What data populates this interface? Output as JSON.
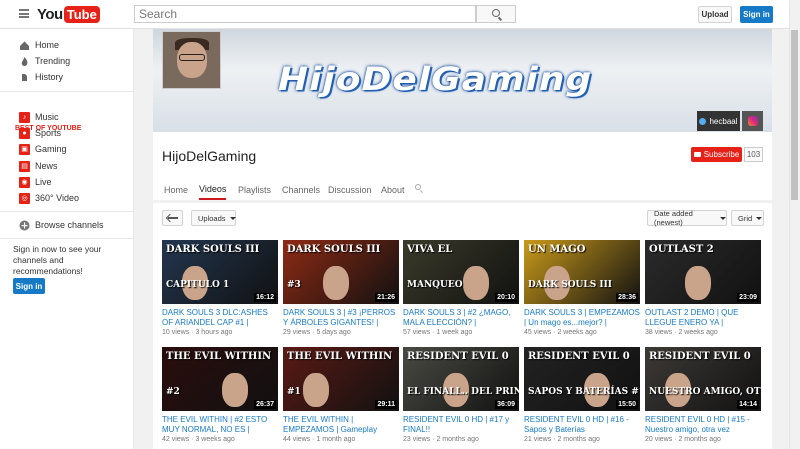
{
  "header": {
    "search_placeholder": "Search",
    "upload_label": "Upload",
    "signin_label": "Sign in",
    "logo_you": "You",
    "logo_tube": "Tube"
  },
  "sidebar": {
    "items": [
      {
        "label": "Home",
        "icon": "home-icon"
      },
      {
        "label": "Trending",
        "icon": "flame-icon"
      },
      {
        "label": "History",
        "icon": "history-icon"
      }
    ],
    "best_heading": "BEST OF YOUTUBE",
    "best_items": [
      {
        "label": "Music",
        "icon": "music-icon"
      },
      {
        "label": "Sports",
        "icon": "sports-icon"
      },
      {
        "label": "Gaming",
        "icon": "gaming-icon"
      },
      {
        "label": "News",
        "icon": "news-icon"
      },
      {
        "label": "Live",
        "icon": "live-icon"
      },
      {
        "label": "360° Video",
        "icon": "360-icon"
      }
    ],
    "browse_label": "Browse channels",
    "signin_text": "Sign in now to see your channels and recommendations!",
    "signin_button": "Sign in"
  },
  "channel": {
    "banner_title": "HijoDelGaming",
    "twitter_handle": "hecbaal",
    "name": "HijoDelGaming",
    "subscribe_label": "Subscribe",
    "subscriber_count": "103",
    "tabs": [
      "Home",
      "Videos",
      "Playlists",
      "Channels",
      "Discussion",
      "About"
    ],
    "active_tab": "Videos"
  },
  "controls": {
    "uploads_label": "Uploads",
    "sort_label": "Date added (newest)",
    "view_label": "Grid"
  },
  "videos": [
    {
      "thumb_text": "DARK SOULS III",
      "thumb_sub": "CAPITULO 1",
      "duration": "16:12",
      "title": "DARK SOULS 3 DLC:ASHES OF ARIANDEL CAP #1 | ENTRAND...",
      "views": "10 views",
      "age": "3 hours ago",
      "bg": "#23364f"
    },
    {
      "thumb_text": "DARK SOULS III",
      "thumb_sub": "#3",
      "duration": "21:26",
      "title": "DARK SOULS 3 | #3 ¡PERROS Y ÁRBOLES GIGANTES! | Gamepl...",
      "views": "29 views",
      "age": "5 days ago",
      "bg": "#8f2a14"
    },
    {
      "thumb_text": "VIVA EL",
      "thumb_sub": "MANQUEO",
      "duration": "20:10",
      "title": "DARK SOULS 3 | #2 ¿MAGO, MALA ELECCIÓN? | Gameplay...",
      "views": "57 views",
      "age": "1 week ago",
      "bg": "#3a3a2a"
    },
    {
      "thumb_text": "UN MAGO",
      "thumb_sub": "DARK SOULS III",
      "duration": "28:36",
      "title": "DARK SOULS 3 | EMPEZAMOS | Un mago es...mejor? | Gamepla...",
      "views": "45 views",
      "age": "2 weeks ago",
      "bg": "#c99a1a"
    },
    {
      "thumb_text": "OUTLAST 2",
      "thumb_sub": "",
      "duration": "23:09",
      "title": "OUTLAST 2 DEMO | QUE LLEGUE ENERO YA | Gameplay Español",
      "views": "38 views",
      "age": "2 weeks ago",
      "bg": "#2b2b2b"
    },
    {
      "thumb_text": "THE EVIL WITHIN",
      "thumb_sub": "#2",
      "duration": "26:37",
      "title": "THE EVIL WITHIN | #2 ESTO MUY NORMAL, NO ES | Gameplay...",
      "views": "42 views",
      "age": "3 weeks ago",
      "bg": "#2a0d0d"
    },
    {
      "thumb_text": "THE EVIL WITHIN",
      "thumb_sub": "#1",
      "duration": "29:11",
      "title": "THE EVIL WITHIN | EMPEZAMOS | Gameplay Español",
      "views": "44 views",
      "age": "1 month ago",
      "bg": "#5a1a14"
    },
    {
      "thumb_text": "RESIDENT EVIL 0",
      "thumb_sub": "EL FINALL.. DEL PRINCIPIO  FIN",
      "duration": "36:09",
      "title": "RESIDENT EVIL 0 HD | #17 y FINAL!!",
      "views": "23 views",
      "age": "2 months ago",
      "bg": "#4a4a44"
    },
    {
      "thumb_text": "RESIDENT EVIL 0",
      "thumb_sub": "SAPOS Y BATERÍAS  #16",
      "duration": "15:50",
      "title": "RESIDENT EVIL 0 HD | #16 - Sapos y Baterías",
      "views": "21 views",
      "age": "2 months ago",
      "bg": "#222"
    },
    {
      "thumb_text": "RESIDENT EVIL 0",
      "thumb_sub": "NUESTRO AMIGO, OTRA VEZ  #15",
      "duration": "14:14",
      "title": "RESIDENT EVIL 0 HD | #15 - Nuestro amigo, otra vez",
      "views": "20 views",
      "age": "2 months ago",
      "bg": "#3d3a36"
    }
  ]
}
